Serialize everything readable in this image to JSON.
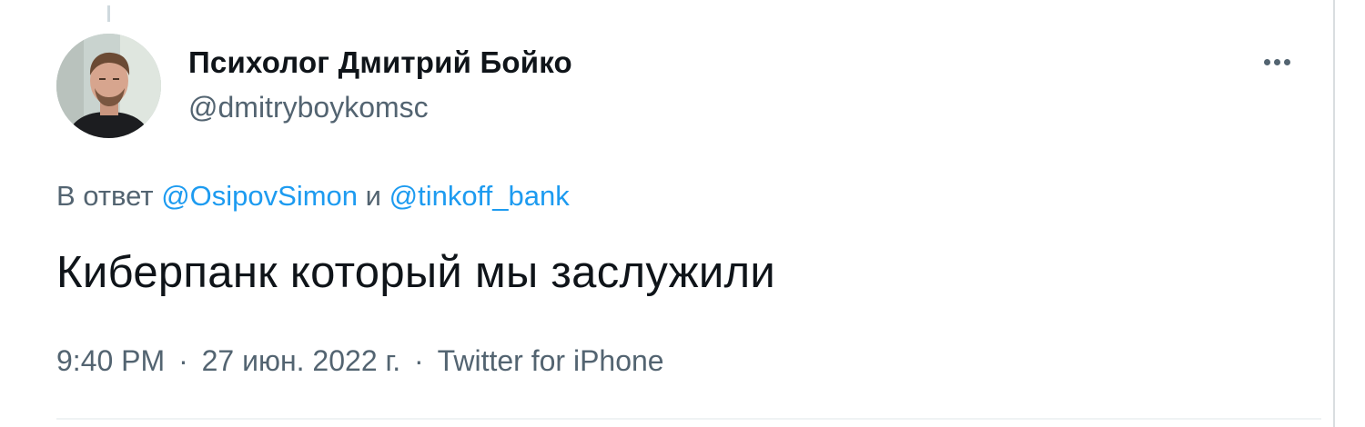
{
  "author": {
    "display_name": "Психолог Дмитрий Бойко",
    "handle": "@dmitryboykomsc"
  },
  "reply": {
    "prefix": "В ответ",
    "mention_1": "@OsipovSimon",
    "conjunction": "и",
    "mention_2": "@tinkoff_bank"
  },
  "tweet": {
    "text": "Киберпанк который мы заслужили"
  },
  "meta": {
    "time": "9:40 PM",
    "separator": "·",
    "date": "27 июн. 2022 г.",
    "source": "Twitter for iPhone"
  },
  "icons": {
    "more": "more-horizontal-icon"
  },
  "colors": {
    "link": "#1d9bf0",
    "secondary_text": "#536471",
    "primary_text": "#0f1419"
  }
}
